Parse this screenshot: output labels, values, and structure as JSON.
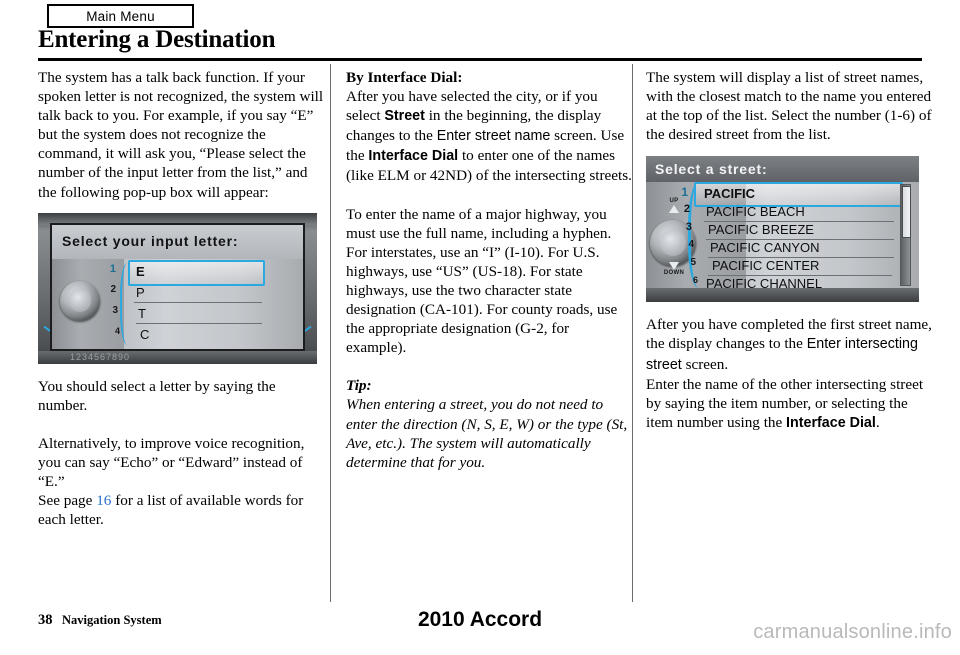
{
  "header": {
    "tab_label": "Main Menu",
    "title": "Entering a Destination"
  },
  "left_column": {
    "paragraph_1": "The system has a talk back function. If your spoken letter is not recognized, the system will talk back to you. For example, if you say “E” but the system does not recognize the command, it will ask you, “Please select the number of the input letter from the list,” and the following pop-up box will appear:",
    "figure": {
      "title": "Select your input letter:",
      "items": [
        {
          "number": "1",
          "label": "E"
        },
        {
          "number": "2",
          "label": "P"
        },
        {
          "number": "3",
          "label": "T"
        },
        {
          "number": "4",
          "label": "C"
        }
      ],
      "selected_index": 0,
      "keyboard_strip": "1234567890"
    },
    "paragraph_2": "You should select a letter by saying the number.",
    "paragraph_3_a": "Alternatively, to improve voice recognition, you can say “Echo” or “Edward” instead of “E.”",
    "paragraph_3_b_pre": "See page ",
    "paragraph_3_b_link": "16",
    "paragraph_3_b_post": " for a list of available words for each letter."
  },
  "middle_column": {
    "heading": "By Interface Dial:",
    "para_1_a": "After you have selected the city, or if you select ",
    "para_1_b": "Street",
    "para_1_c": " in the beginning, the display changes to the ",
    "para_1_d": "Enter street name",
    "para_1_e": " screen. Use the ",
    "para_1_f": "Interface Dial",
    "para_1_g": " to enter one of the names (like ELM or 42ND) of the intersecting streets.",
    "para_2": "To enter the name of a major highway, you must use the full name, including a hyphen. For interstates, use an “I” (I-10). For U.S. highways, use “US” (US-18). For state highways, use the two character state designation (CA-101). For county roads, use the appropriate designation (G-2, for example).",
    "tip_heading": "Tip:",
    "tip_body": "When entering a street, you do not need to enter the direction (N, S, E, W) or the type (St, Ave, etc.). The system will automatically determine that for you."
  },
  "right_column": {
    "paragraph_1": "The system will display a list of street names, with the closest match to the name you entered at the top of the list. Select the number (1-6) of the desired street from the list.",
    "figure": {
      "title": "Select a street:",
      "dial_up_label": "UP",
      "dial_down_label": "DOWN",
      "items": [
        {
          "number": "1",
          "label": "PACIFIC"
        },
        {
          "number": "2",
          "label": "PACIFIC BEACH"
        },
        {
          "number": "3",
          "label": "PACIFIC BREEZE"
        },
        {
          "number": "4",
          "label": "PACIFIC CANYON"
        },
        {
          "number": "5",
          "label": "PACIFIC CENTER"
        },
        {
          "number": "6",
          "label": "PACIFIC CHANNEL"
        }
      ],
      "selected_index": 0
    },
    "para_2_a": "After you have completed the first street name, the display changes to the ",
    "para_2_b": "Enter intersecting street",
    "para_2_c": " screen.",
    "para_3_a": "Enter the name of the other intersecting street by saying the item number, or selecting the item number using the ",
    "para_3_b": "Interface Dial",
    "para_3_c": "."
  },
  "footer": {
    "page_number": "38",
    "section": "Navigation System",
    "model": "2010 Accord",
    "watermark": "carmanualsonline.info"
  },
  "colors": {
    "accent_blue": "#2aa8e0",
    "link_blue": "#2a6fc9",
    "rule_black": "#000000",
    "watermark_gray": "#b9b9b9"
  }
}
